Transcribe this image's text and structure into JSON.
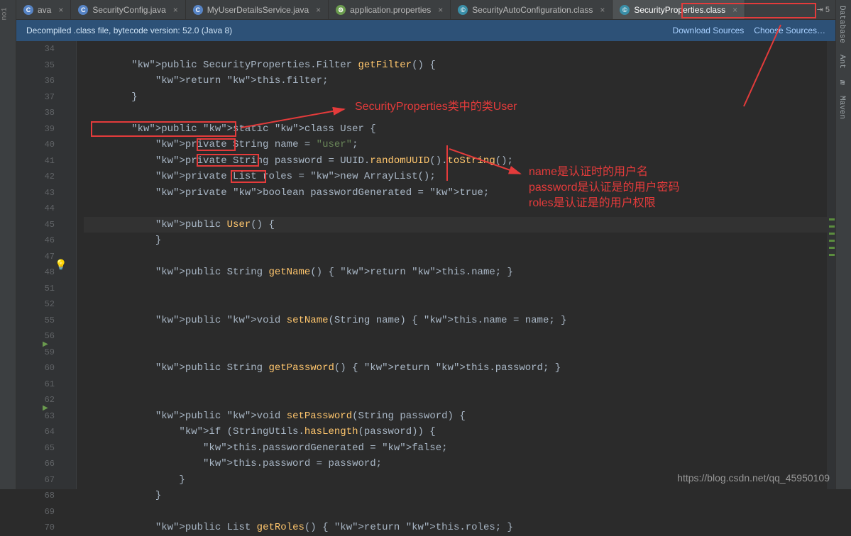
{
  "tabs": [
    {
      "label": "ava",
      "icon": "java",
      "trunc": true
    },
    {
      "label": "SecurityConfig.java",
      "icon": "java"
    },
    {
      "label": "MyUserDetailsService.java",
      "icon": "java"
    },
    {
      "label": "application.properties",
      "icon": "prop"
    },
    {
      "label": "SecurityAutoConfiguration.class",
      "icon": "cls"
    },
    {
      "label": "SecurityProperties.class",
      "icon": "cls",
      "active": true
    }
  ],
  "rightToolButtons": [
    "Database",
    "Ant",
    "m",
    "Maven"
  ],
  "banner": {
    "text": "Decompiled .class file, bytecode version: 52.0 (Java 8)",
    "link1": "Download Sources",
    "link2": "Choose Sources…"
  },
  "lineStart": 34,
  "code": [
    "",
    "        public SecurityProperties.Filter getFilter() {",
    "            return this.filter;",
    "        }",
    "",
    "        public static class User {",
    "            private String name = \"user\";",
    "            private String password = UUID.randomUUID().toString();",
    "            private List<String> roles = new ArrayList();",
    "            private boolean passwordGenerated = true;",
    "",
    "            public User() {",
    "            }",
    "",
    "            public String getName() { return this.name; }",
    "",
    "",
    "            public void setName(String name) { this.name = name; }",
    "",
    "",
    "            public String getPassword() { return this.password; }",
    "",
    "",
    "            public void setPassword(String password) {",
    "                if (StringUtils.hasLength(password)) {",
    "                    this.passwordGenerated = false;",
    "                    this.password = password;",
    "                }",
    "            }",
    "",
    "            public List<String> getRoles() { return this.roles; }"
  ],
  "hiddenLines": [
    49,
    50,
    53,
    54,
    57,
    58
  ],
  "annotations": {
    "top": "SecurityProperties类中的类User",
    "right": "name是认证时的用户名\npassword是认证是的用户密码\nroles是认证是的用户权限"
  },
  "watermark": "https://blog.csdn.net/qq_45950109"
}
